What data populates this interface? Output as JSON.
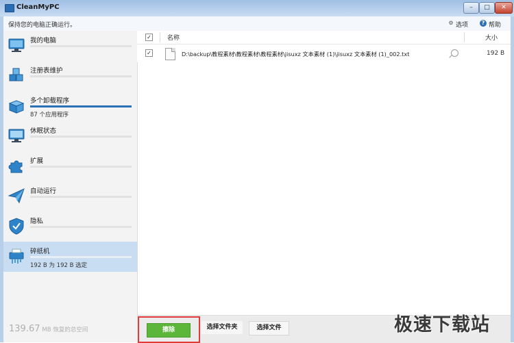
{
  "window": {
    "title": "CleanMyPC",
    "status_text": "保持您的电脑正确运行。",
    "options_label": "选项",
    "help_label": "帮助"
  },
  "sidebar": {
    "items": [
      {
        "label": "我的电脑",
        "icon": "computer-icon",
        "progress": 0
      },
      {
        "label": "注册表维护",
        "icon": "registry-cubes-icon",
        "progress": 0
      },
      {
        "label": "多个卸载程序",
        "icon": "uninstaller-box-icon",
        "progress": 1.0,
        "sub": "87 个应用程序"
      },
      {
        "label": "休眠状态",
        "icon": "hibernate-monitor-icon",
        "progress": 0
      },
      {
        "label": "扩展",
        "icon": "puzzle-icon",
        "progress": 0
      },
      {
        "label": "自动运行",
        "icon": "paper-plane-icon",
        "progress": 0
      },
      {
        "label": "隐私",
        "icon": "shield-icon",
        "progress": 0
      },
      {
        "label": "碎纸机",
        "icon": "shredder-icon",
        "progress": 0,
        "sub": "192 B 为 192 B 选定",
        "selected": true
      }
    ],
    "reclaim_value": "139.67",
    "reclaim_unit": "MB",
    "reclaim_text": "恢复的总空间"
  },
  "list": {
    "header_name": "名称",
    "header_size": "大小",
    "rows": [
      {
        "path": "D:\\backup\\教程素材\\教程素材\\教程素材\\jisuxz 文本素材 (1)\\jisuxz 文本素材 (1)_002.txt",
        "size": "192 B",
        "checked": true
      }
    ]
  },
  "toolbar": {
    "erase_label": "擦除",
    "select_folder_label": "选择文件夹",
    "select_file_label": "选择文件"
  },
  "watermark": "极速下载站",
  "colors": {
    "accent_blue": "#2a6fb8",
    "erase_green": "#5cb63a",
    "highlight_red": "#e23a3a",
    "selected_bg": "#c8ddf2"
  }
}
